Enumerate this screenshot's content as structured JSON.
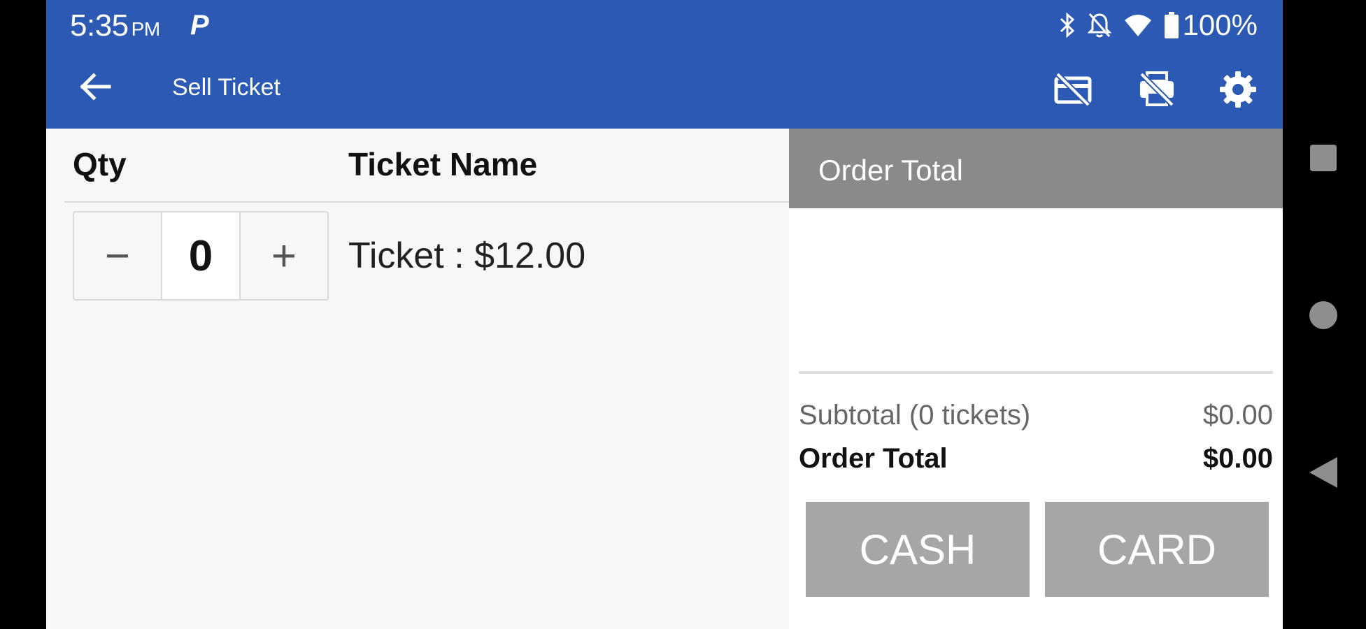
{
  "status_bar": {
    "time": "5:35",
    "ampm": "PM",
    "notification_icon": "p-icon",
    "battery": "100%"
  },
  "app_bar": {
    "title": "Sell Ticket",
    "icons": [
      "back-arrow-icon",
      "card-off-icon",
      "printer-off-icon",
      "gear-icon"
    ]
  },
  "table": {
    "columns": [
      "Qty",
      "Ticket Name"
    ],
    "rows": [
      {
        "qty": "0",
        "name": "Ticket : $12.00",
        "minus": "−",
        "plus": "+"
      }
    ]
  },
  "order": {
    "title": "Order Total",
    "subtotal_label": "Subtotal (0 tickets)",
    "subtotal_value": "$0.00",
    "total_label": "Order Total",
    "total_value": "$0.00",
    "cash_label": "CASH",
    "card_label": "CARD"
  },
  "colors": {
    "primary": "#2b59b3",
    "header_gray": "#8a8a8a",
    "button_gray": "#a6a6a6"
  }
}
